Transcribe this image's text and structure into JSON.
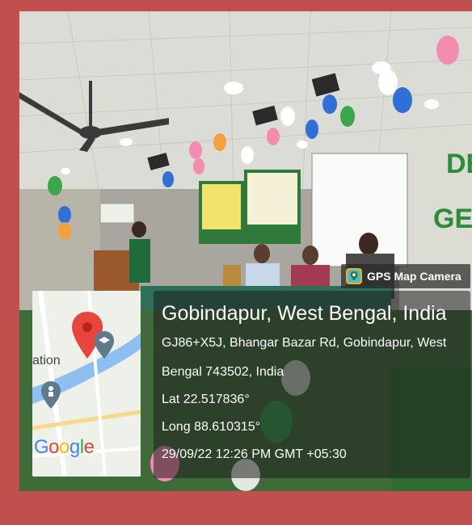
{
  "colors": {
    "border": "#c0504d",
    "overlay": "#1e1e1e",
    "text": "#ffffff",
    "map_pin": "#e8453c"
  },
  "app_tag": {
    "name": "GPS Map Camera",
    "icon": "gps-map-camera-icon"
  },
  "location": {
    "title": "Gobindapur, West Bengal, India",
    "address_line1": "GJ86+X5J, Bhangar Bazar Rd, Gobindapur, West",
    "address_line2": "Bengal 743502, India",
    "latitude": "Lat 22.517836°",
    "longitude": "Long 88.610315°",
    "datetime": "29/09/22 12:26 PM GMT +05:30"
  },
  "map": {
    "partial_label": "ation",
    "logo": [
      "G",
      "o",
      "o",
      "g",
      "l",
      "e"
    ],
    "logo_colors": [
      "#4285F4",
      "#EA4335",
      "#FBBC05",
      "#4285F4",
      "#34A853",
      "#EA4335"
    ],
    "pin_icon": "map-pin-icon",
    "place_icons": [
      "school-icon",
      "person-marker-icon"
    ]
  },
  "scene": {
    "wall_text_partial": [
      "DE",
      "GE"
    ]
  }
}
